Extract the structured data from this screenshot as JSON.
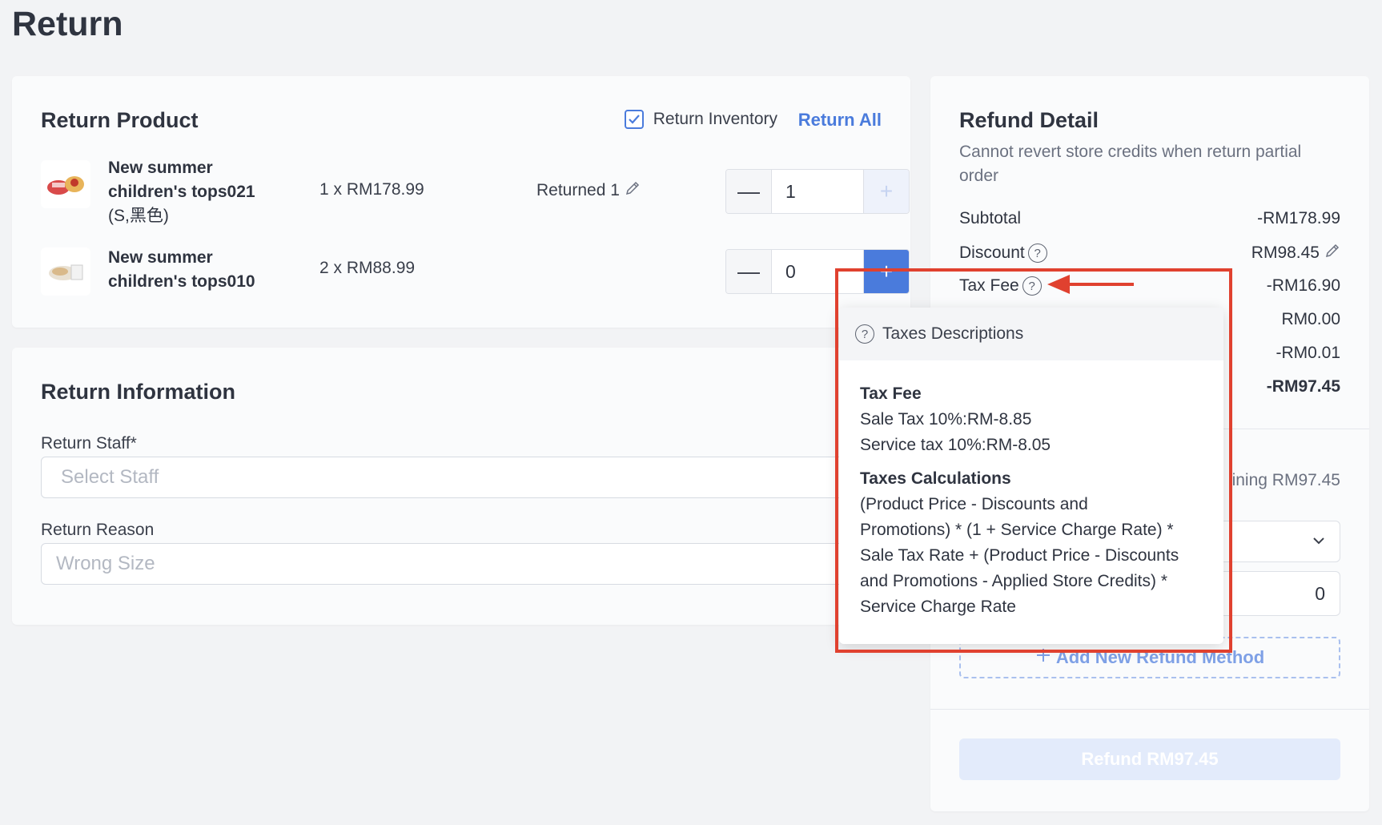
{
  "page": {
    "title": "Return"
  },
  "return_product": {
    "title": "Return Product",
    "return_inventory_label": "Return Inventory",
    "return_inventory_checked": true,
    "return_all_label": "Return All",
    "items": [
      {
        "name_line1": "New summer",
        "name_line2": "children's tops021",
        "variant": "(S,黑色)",
        "price": "1 x RM178.99",
        "returned": "Returned 1",
        "quantity": "1",
        "minus": "—",
        "plus": "+"
      },
      {
        "name_line1": "New summer",
        "name_line2": "children's tops010",
        "variant": "",
        "price": "2 x RM88.99",
        "returned": "",
        "quantity": "0",
        "minus": "—",
        "plus": "+"
      }
    ]
  },
  "return_information": {
    "title": "Return Information",
    "staff_label": "Return Staff*",
    "staff_placeholder": "Select Staff",
    "reason_label": "Return Reason",
    "reason_placeholder": "Wrong Size"
  },
  "refund_detail": {
    "title": "Refund Detail",
    "note": "Cannot revert store credits when return partial order",
    "rows": [
      {
        "label": "Subtotal",
        "value": "-RM178.99"
      },
      {
        "label": "Discount",
        "value": "RM98.45"
      },
      {
        "label": "Tax Fee",
        "value": "-RM16.90"
      },
      {
        "label": "",
        "value": "RM0.00"
      },
      {
        "label": "",
        "value": "-RM0.01"
      },
      {
        "label": "",
        "value": "-RM97.45"
      }
    ],
    "remaining": "ining RM97.45",
    "amount_value": "0",
    "add_method_label": "Add New Refund Method",
    "refund_button": "Refund RM97.45"
  },
  "tax_popover": {
    "header": "Taxes Descriptions",
    "tax_fee_heading": "Tax Fee",
    "sale_tax": "Sale Tax 10%:RM-8.85",
    "service_tax": "Service tax 10%:RM-8.05",
    "calc_heading": "Taxes Calculations",
    "calc_lines": [
      "(Product Price - Discounts and",
      "Promotions) * (1 + Service Charge Rate) *",
      "Sale Tax Rate + (Product Price - Discounts",
      "and Promotions - Applied Store Credits) *",
      "Service Charge Rate"
    ]
  },
  "colors": {
    "accent": "#4a7bdc",
    "annotation": "#e0412f"
  }
}
